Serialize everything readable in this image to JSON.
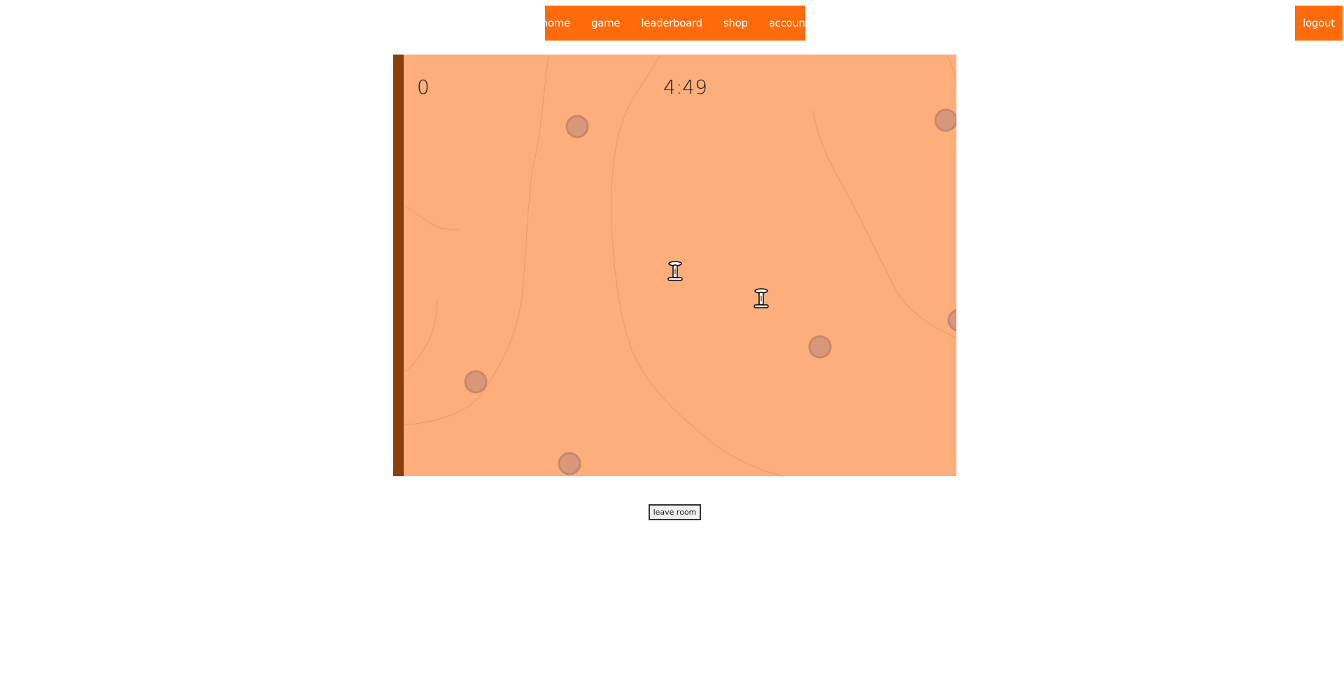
{
  "nav": {
    "items": [
      {
        "label": "home"
      },
      {
        "label": "game"
      },
      {
        "label": "leaderboard"
      },
      {
        "label": "shop"
      },
      {
        "label": "account"
      }
    ],
    "logout_label": "logout"
  },
  "game": {
    "score": "0",
    "timer": "4:49"
  },
  "actions": {
    "leave_room_label": "leave room"
  },
  "colors": {
    "nav_bg": "#ff6a0a",
    "field_bg": "#fdae7b",
    "wall": "#8a3e0a",
    "rock": "#d9977a"
  }
}
